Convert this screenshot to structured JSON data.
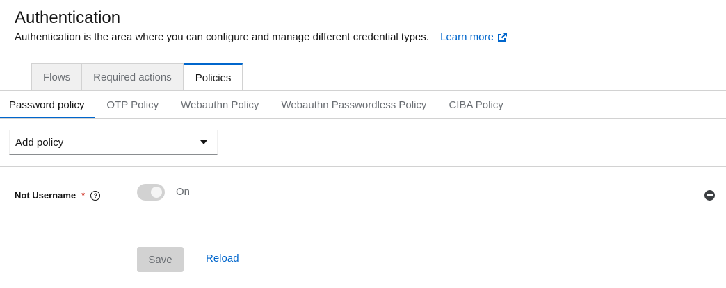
{
  "header": {
    "title": "Authentication",
    "description": "Authentication is the area where you can configure and manage different credential types.",
    "learn_more": "Learn more",
    "learn_more_icon": "external-link-icon"
  },
  "tabs": [
    {
      "label": "Flows",
      "active": false
    },
    {
      "label": "Required actions",
      "active": false
    },
    {
      "label": "Policies",
      "active": true
    }
  ],
  "sub_tabs": [
    {
      "label": "Password policy",
      "active": true
    },
    {
      "label": "OTP Policy",
      "active": false
    },
    {
      "label": "Webauthn Policy",
      "active": false
    },
    {
      "label": "Webauthn Passwordless Policy",
      "active": false
    },
    {
      "label": "CIBA Policy",
      "active": false
    }
  ],
  "add_policy": {
    "label": "Add policy",
    "icon": "caret-down-icon"
  },
  "policy": {
    "label": "Not Username",
    "required_marker": "*",
    "help_icon": "question-circle-icon",
    "toggle_on": true,
    "toggle_label": "On",
    "remove_icon": "minus-circle-icon"
  },
  "actions": {
    "save": "Save",
    "reload": "Reload"
  },
  "colors": {
    "accent": "#0066cc",
    "required": "#c9190b",
    "disabled": "#d2d2d2"
  }
}
